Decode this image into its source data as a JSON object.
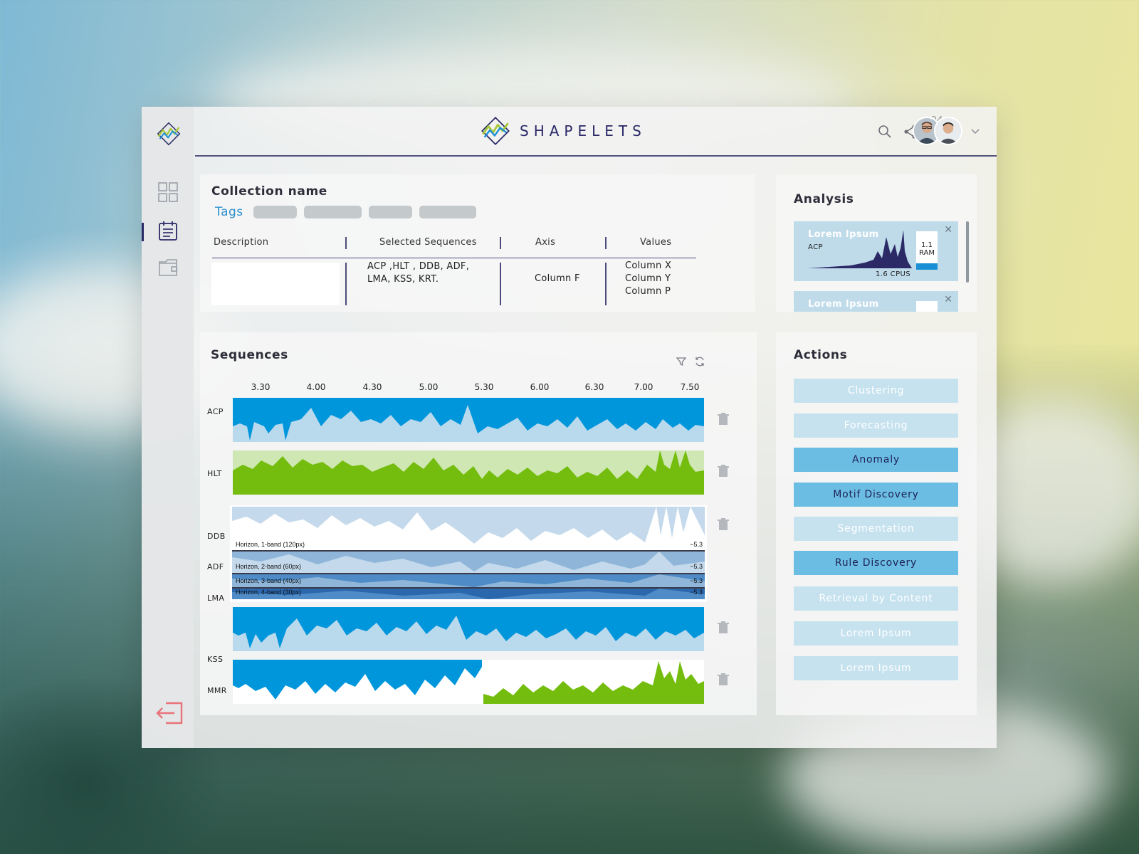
{
  "brand": {
    "name": "SHAPELETS"
  },
  "header": {
    "notification_count": "24"
  },
  "collection": {
    "title": "Collection name",
    "tags_label": "Tags",
    "columns": [
      "Description",
      "Selected Sequences",
      "Axis",
      "Values"
    ],
    "selected_sequences": "ACP ,HLT , DDB, ADF,\nLMA, KSS, KRT.",
    "axis": "Column F",
    "values": [
      "Column X",
      "Column Y",
      "Column P"
    ]
  },
  "analysis": {
    "title": "Analysis",
    "cards": [
      {
        "title": "Lorem Ipsum",
        "series": "ACP",
        "ram": "1.1\nRAM",
        "cpu": "1.6 CPUS"
      },
      {
        "title": "Lorem Ipsum"
      }
    ]
  },
  "sequences": {
    "title": "Sequences",
    "ticks": [
      "3.30",
      "4.00",
      "4.30",
      "5.00",
      "5.30",
      "6.00",
      "6.30",
      "7.00",
      "7.50"
    ],
    "row_labels": [
      "ACP",
      "HLT",
      "DDB",
      "ADF",
      "LMA",
      "KSS",
      "MMR"
    ],
    "horizon": [
      {
        "label": "Horizon, 1-band (120px)",
        "value": "−5.3"
      },
      {
        "label": "Horizon, 2-band (60px)",
        "value": "−5.3"
      },
      {
        "label": "Horizon, 3-band (40px)",
        "value": "−5.3"
      },
      {
        "label": "Horizon, 4-band (30px)",
        "value": "−5.3"
      }
    ]
  },
  "actions": {
    "title": "Actions",
    "buttons": [
      {
        "label": "Clustering",
        "active": false
      },
      {
        "label": "Forecasting",
        "active": false
      },
      {
        "label": "Anomaly",
        "active": true
      },
      {
        "label": "Motif Discovery",
        "active": true
      },
      {
        "label": "Segmentation",
        "active": false
      },
      {
        "label": "Rule Discovery",
        "active": true
      },
      {
        "label": "Retrieval by Content",
        "active": false
      },
      {
        "label": "Lorem Ipsum",
        "active": false
      },
      {
        "label": "Lorem Ipsum",
        "active": false
      }
    ]
  },
  "colors": {
    "navy": "#2b2966",
    "blue": "#0096dc",
    "light_blue": "#bfdbea",
    "green": "#74bd0f",
    "light_green": "#cfe7b2",
    "logout": "#e8737a"
  },
  "icons": [
    "app-logo",
    "dashboard-icon",
    "calendar-icon",
    "folder-icon",
    "logout-icon",
    "search-icon",
    "share-icon",
    "bell-icon",
    "chevron-down-icon",
    "filter-icon",
    "refresh-icon",
    "trash-icon",
    "close-icon"
  ]
}
